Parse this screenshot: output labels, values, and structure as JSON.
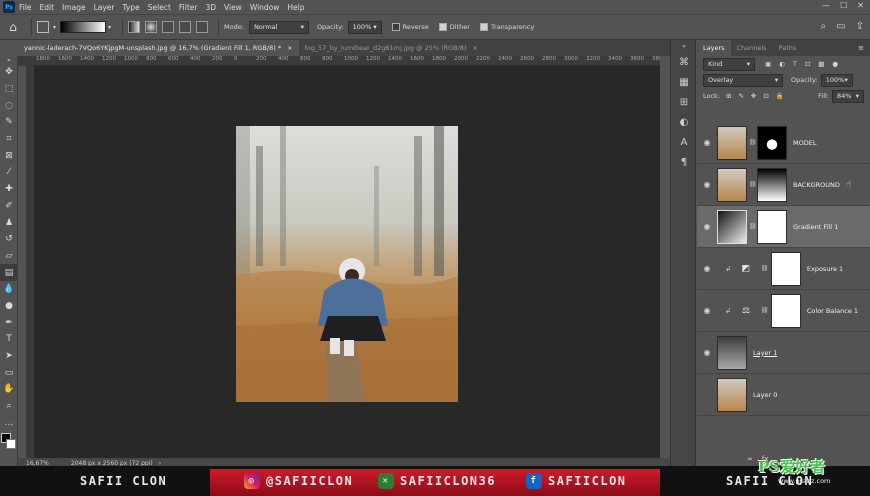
{
  "app": {
    "logo": "Ps"
  },
  "menubar": {
    "items": [
      "File",
      "Edit",
      "Image",
      "Layer",
      "Type",
      "Select",
      "Filter",
      "3D",
      "View",
      "Window",
      "Help"
    ]
  },
  "options": {
    "mode_label": "Mode:",
    "mode_value": "Normal",
    "opacity_label": "Opacity:",
    "opacity_value": "100%",
    "reverse": "Reverse",
    "dither": "Dither",
    "transparency": "Transparency"
  },
  "tabs": [
    {
      "label": "yannic-laderach-7VQo6YKjpgM-unsplash.jpg @ 16,7% (Gradient Fill 1, RGB/8) *",
      "active": true
    },
    {
      "label": "fog_57_by_lumibear_d2g61mj.jpg @ 25% (RGB/8)",
      "active": false
    }
  ],
  "ruler": {
    "top": [
      "1800",
      "1600",
      "1400",
      "1200",
      "1000",
      "800",
      "600",
      "400",
      "200",
      "0",
      "200",
      "400",
      "600",
      "800",
      "1000",
      "1200",
      "1400",
      "1600",
      "1800",
      "2000",
      "2200",
      "2400",
      "2600",
      "2800",
      "3000",
      "3200",
      "3400",
      "3600",
      "3800"
    ]
  },
  "status": {
    "zoom": "16,67%",
    "doc": "2048 px x 2560 px (72 ppi)"
  },
  "panel": {
    "tabs": [
      "Layers",
      "Channels",
      "Paths"
    ],
    "kind_label": "Kind",
    "blend": "Overlay",
    "opacity_label": "Opacity:",
    "opacity_value": "100%",
    "lock_label": "Lock:",
    "fill_label": "Fill:",
    "fill_value": "84%",
    "layers": [
      {
        "name": "MODEL"
      },
      {
        "name": "BACKGROUND"
      },
      {
        "name": "Gradient Fill 1"
      },
      {
        "name": "Exposure 1"
      },
      {
        "name": "Color Balance 1"
      },
      {
        "name": "Layer 1"
      },
      {
        "name": "Layer 0"
      }
    ]
  },
  "banner": {
    "left": "SAFII CLON",
    "instagram": "@SAFIICLON",
    "xbox": "SAFIICLON36",
    "facebook": "SAFIICLON",
    "right": "SAFII CLON",
    "watermark": "PS爱好者",
    "watermark_url": "www.psahz.com"
  },
  "colors": {
    "accent": "#d01a2b",
    "panel": "#535353",
    "canvas": "#282828"
  }
}
